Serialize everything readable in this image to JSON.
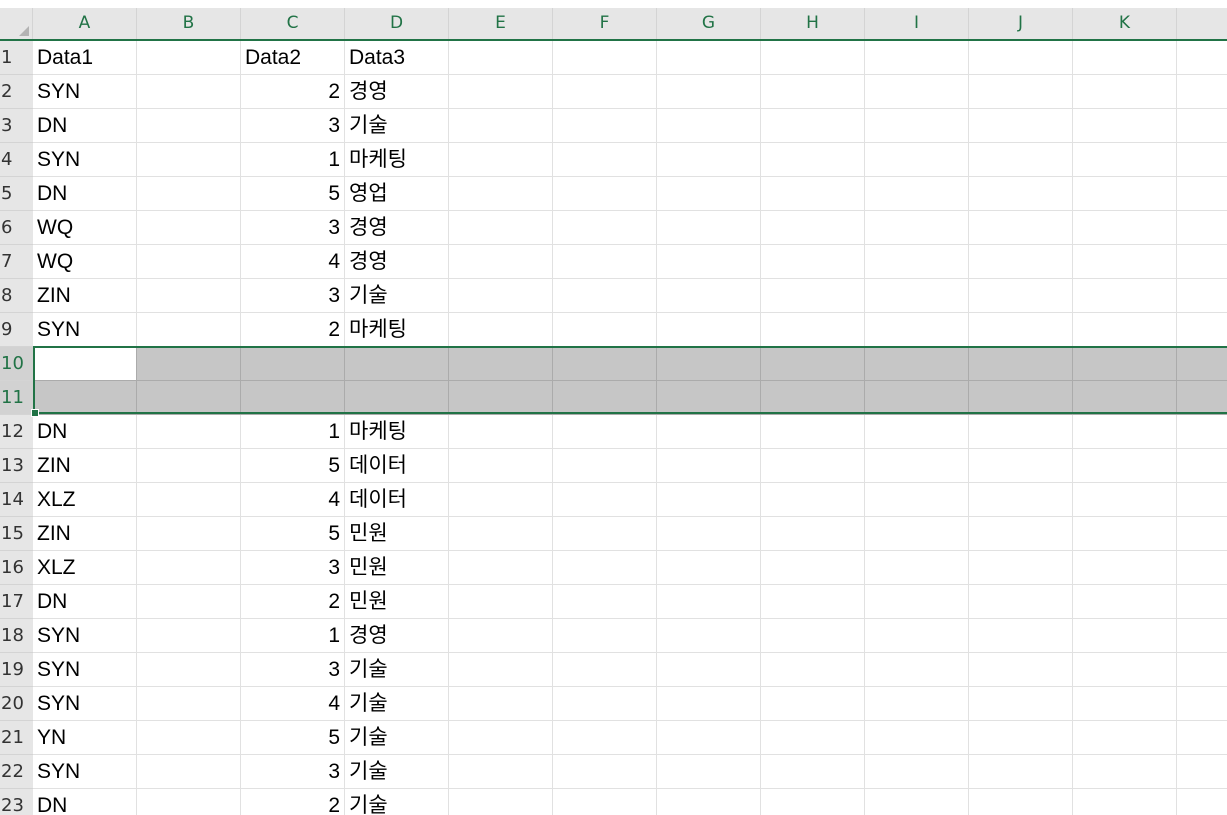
{
  "columns": [
    "A",
    "B",
    "C",
    "D",
    "E",
    "F",
    "G",
    "H",
    "I",
    "J",
    "K"
  ],
  "rows": [
    {
      "n": "1",
      "a": "Data1",
      "c": "Data2",
      "d": "Data3"
    },
    {
      "n": "2",
      "a": "SYN",
      "c": "2",
      "d": "경영"
    },
    {
      "n": "3",
      "a": "DN",
      "c": "3",
      "d": "기술"
    },
    {
      "n": "4",
      "a": "SYN",
      "c": "1",
      "d": "마케팅"
    },
    {
      "n": "5",
      "a": "DN",
      "c": "5",
      "d": "영업"
    },
    {
      "n": "6",
      "a": "WQ",
      "c": "3",
      "d": "경영"
    },
    {
      "n": "7",
      "a": "WQ",
      "c": "4",
      "d": "경영"
    },
    {
      "n": "8",
      "a": "ZIN",
      "c": "3",
      "d": "기술"
    },
    {
      "n": "9",
      "a": "SYN",
      "c": "2",
      "d": "마케팅"
    },
    {
      "n": "10",
      "a": "",
      "c": "",
      "d": ""
    },
    {
      "n": "11",
      "a": "",
      "c": "",
      "d": ""
    },
    {
      "n": "12",
      "a": "DN",
      "c": "1",
      "d": "마케팅"
    },
    {
      "n": "13",
      "a": "ZIN",
      "c": "5",
      "d": "데이터"
    },
    {
      "n": "14",
      "a": "XLZ",
      "c": "4",
      "d": "데이터"
    },
    {
      "n": "15",
      "a": "ZIN",
      "c": "5",
      "d": "민원"
    },
    {
      "n": "16",
      "a": "XLZ",
      "c": "3",
      "d": "민원"
    },
    {
      "n": "17",
      "a": "DN",
      "c": "2",
      "d": "민원"
    },
    {
      "n": "18",
      "a": "SYN",
      "c": "1",
      "d": "경영"
    },
    {
      "n": "19",
      "a": "SYN",
      "c": "3",
      "d": "기술"
    },
    {
      "n": "20",
      "a": "SYN",
      "c": "4",
      "d": "기술"
    },
    {
      "n": "21",
      "a": "YN",
      "c": "5",
      "d": "기술"
    },
    {
      "n": "22",
      "a": "SYN",
      "c": "3",
      "d": "기술"
    },
    {
      "n": "23",
      "a": "DN",
      "c": "2",
      "d": "기술"
    }
  ],
  "selection": {
    "rows": [
      "10",
      "11"
    ],
    "active_cell": "A10"
  },
  "colors": {
    "accent": "#217346",
    "header_bg": "#e6e6e6",
    "selection_bg": "#c6c6c6",
    "gridline": "#e1e1e1"
  }
}
